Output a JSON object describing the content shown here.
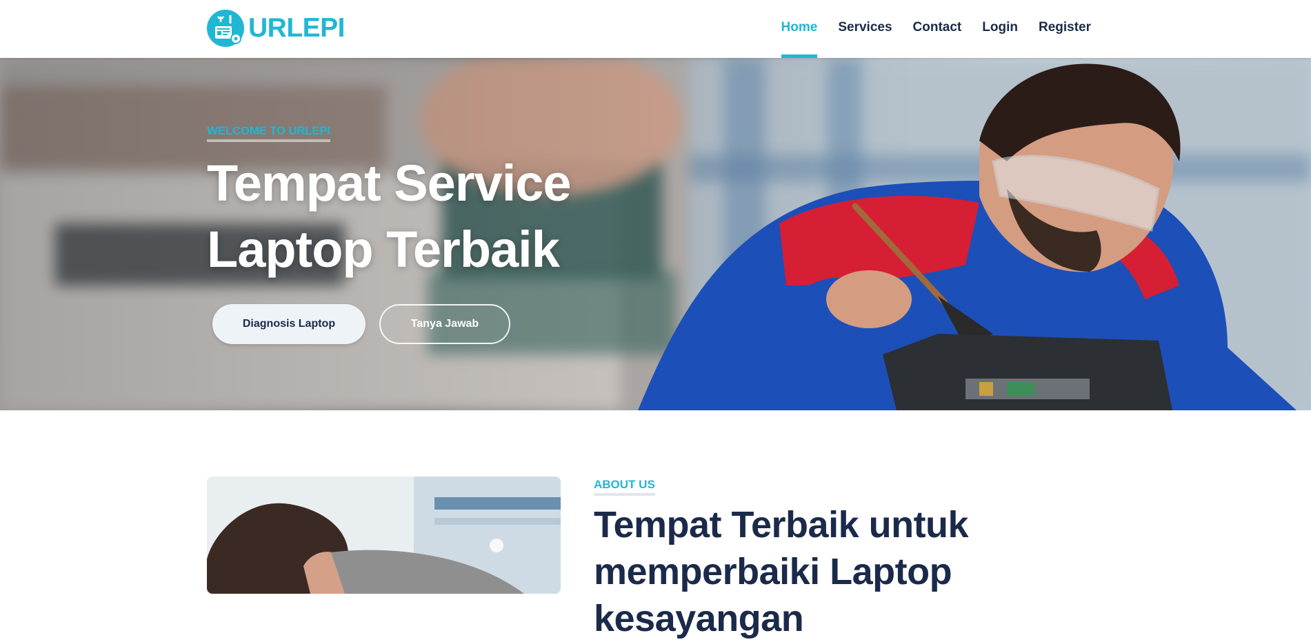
{
  "brand": {
    "name": "URLEPI",
    "color": "#1fb7d4"
  },
  "nav": {
    "items": [
      {
        "label": "Home",
        "active": true
      },
      {
        "label": "Services",
        "active": false
      },
      {
        "label": "Contact",
        "active": false
      },
      {
        "label": "Login",
        "active": false
      },
      {
        "label": "Register",
        "active": false
      }
    ]
  },
  "hero": {
    "kicker": "WELCOME TO URLEPI",
    "title": "Tempat Service Laptop Terbaik",
    "buttons": {
      "primary": "Diagnosis Laptop",
      "secondary": "Tanya Jawab"
    }
  },
  "about": {
    "kicker": "ABOUT US",
    "title": "Tempat Terbaik untuk memperbaiki Laptop kesayangan"
  },
  "colors": {
    "accent": "#1fb7d4",
    "dark": "#1b2a4a",
    "button_light": "#eef3f8"
  },
  "icons": {
    "brand": "laptop-repair-icon"
  }
}
